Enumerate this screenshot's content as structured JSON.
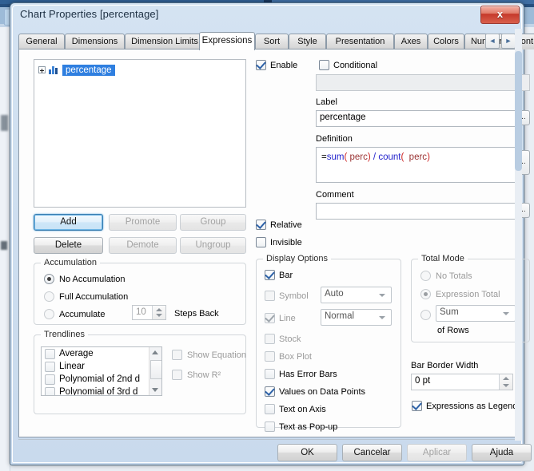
{
  "window": {
    "title": "Chart Properties [percentage]",
    "close_label": "x"
  },
  "tabs": {
    "items": [
      {
        "label": "General",
        "active": false
      },
      {
        "label": "Dimensions",
        "active": false
      },
      {
        "label": "Dimension Limits",
        "active": false
      },
      {
        "label": "Expressions",
        "active": true
      },
      {
        "label": "Sort",
        "active": false
      },
      {
        "label": "Style",
        "active": false
      },
      {
        "label": "Presentation",
        "active": false
      },
      {
        "label": "Axes",
        "active": false
      },
      {
        "label": "Colors",
        "active": false
      },
      {
        "label": "Number",
        "active": false
      },
      {
        "label": "Font",
        "active": false
      }
    ],
    "scroll_left": "◄",
    "scroll_right": "►"
  },
  "expression_tree": {
    "items": [
      {
        "label": "percentage",
        "selected": true,
        "expander": "+",
        "icon": "bar-chart-icon"
      }
    ]
  },
  "list_buttons": {
    "add": "Add",
    "delete": "Delete",
    "promote": "Promote",
    "demote": "Demote",
    "group": "Group",
    "ungroup": "Ungroup"
  },
  "accumulation": {
    "title": "Accumulation",
    "no_accumulation": "No Accumulation",
    "full_accumulation": "Full Accumulation",
    "accumulate": "Accumulate",
    "steps_value": "10",
    "steps_back": "Steps Back",
    "selected": "no_accumulation"
  },
  "trendlines": {
    "title": "Trendlines",
    "items": [
      {
        "label": "Average",
        "checked": false
      },
      {
        "label": "Linear",
        "checked": false
      },
      {
        "label": "Polynomial of 2nd d",
        "checked": false
      },
      {
        "label": "Polynomial of 3rd d",
        "checked": false
      }
    ],
    "show_equation": "Show Equation",
    "show_r2": "Show R²"
  },
  "expression_settings": {
    "enable": "Enable",
    "enable_checked": true,
    "conditional": "Conditional",
    "conditional_checked": false,
    "conditional_value": "",
    "label_caption": "Label",
    "label_value": "percentage",
    "definition_caption": "Definition",
    "definition_value": "=sum( perc) / count( perc)",
    "definition_tokens": [
      {
        "t": "=",
        "c": "plain"
      },
      {
        "t": "sum",
        "c": "k"
      },
      {
        "t": "(",
        "c": "p"
      },
      {
        "t": " perc",
        "c": "f"
      },
      {
        "t": ")",
        "c": "p"
      },
      {
        "t": " / ",
        "c": "k"
      },
      {
        "t": "count",
        "c": "k"
      },
      {
        "t": "(",
        "c": "p"
      },
      {
        "t": "  perc",
        "c": "f"
      },
      {
        "t": ")",
        "c": "p"
      }
    ],
    "comment_caption": "Comment",
    "comment_value": "",
    "ellipsis": "...",
    "relative": "Relative",
    "relative_checked": true,
    "invisible": "Invisible",
    "invisible_checked": false
  },
  "display_options": {
    "title": "Display Options",
    "bar": "Bar",
    "bar_checked": true,
    "symbol": "Symbol",
    "symbol_checked": false,
    "symbol_combo": "Auto",
    "line": "Line",
    "line_checked": true,
    "line_combo": "Normal",
    "stock": "Stock",
    "stock_checked": false,
    "box_plot": "Box Plot",
    "box_plot_checked": false,
    "has_error_bars": "Has Error Bars",
    "has_error_bars_checked": false,
    "values_on_data_points": "Values on Data Points",
    "values_on_data_points_checked": true,
    "text_on_axis": "Text on Axis",
    "text_on_axis_checked": false,
    "text_as_popup": "Text as Pop-up",
    "text_as_popup_checked": false
  },
  "total_mode": {
    "title": "Total Mode",
    "no_totals": "No Totals",
    "expression_total": "Expression Total",
    "aggregation": "Sum",
    "of_rows": "of Rows",
    "selected": "expression_total"
  },
  "bar_border": {
    "caption": "Bar Border Width",
    "value": "0 pt"
  },
  "legend": {
    "expressions_as_legend": "Expressions as Legend",
    "checked": true
  },
  "footer": {
    "ok": "OK",
    "cancel": "Cancelar",
    "apply": "Aplicar",
    "help": "Ajuda"
  },
  "colors": {
    "accent": "#2f7fe0",
    "check": "#2e62a8",
    "title_text": "#1d2f42",
    "close_red": "#c5382a",
    "keyword": "#2222cc",
    "paren": "#cc2222",
    "field": "#993333"
  }
}
